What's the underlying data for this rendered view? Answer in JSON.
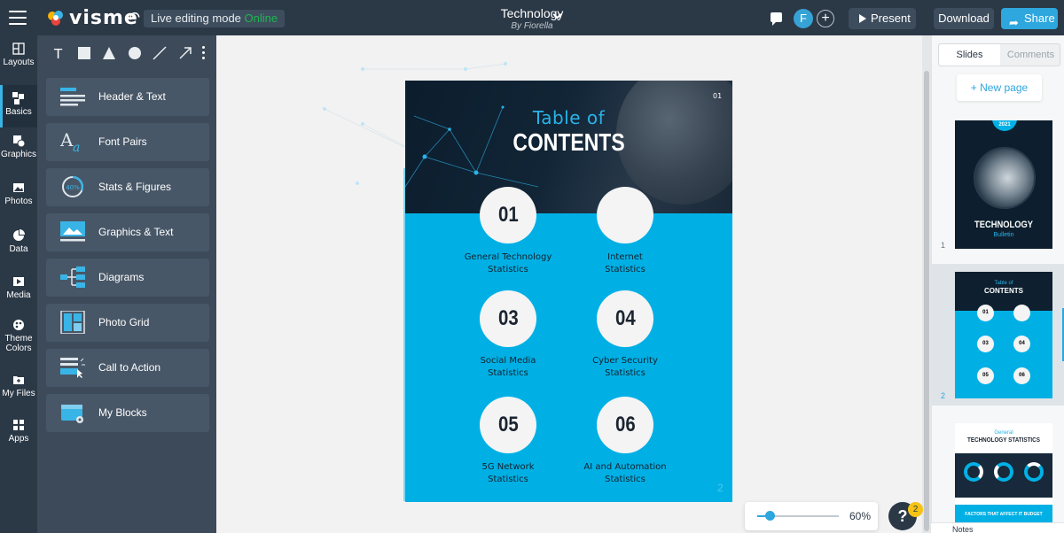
{
  "app": {
    "brand": "visme",
    "mode_label": "Live editing mode",
    "mode_status": "Online",
    "doc_title": "Technology",
    "doc_author": "By Fiorella",
    "user_initial": "F",
    "present_label": "Present",
    "download_label": "Download",
    "share_label": "Share"
  },
  "rail": [
    {
      "label": "Layouts",
      "icon": "layouts-icon"
    },
    {
      "label": "Basics",
      "icon": "basics-icon"
    },
    {
      "label": "Graphics",
      "icon": "graphics-icon"
    },
    {
      "label": "Photos",
      "icon": "photos-icon"
    },
    {
      "label": "Data",
      "icon": "data-icon"
    },
    {
      "label": "Media",
      "icon": "media-icon"
    },
    {
      "label": "Theme",
      "label2": "Colors",
      "icon": "theme-colors-icon"
    },
    {
      "label": "My Files",
      "icon": "my-files-icon"
    },
    {
      "label": "Apps",
      "icon": "apps-icon"
    }
  ],
  "tools": [
    "text-tool-icon",
    "rectangle-tool-icon",
    "triangle-tool-icon",
    "circle-tool-icon",
    "line-tool-icon",
    "arrow-tool-icon"
  ],
  "blocks": [
    {
      "label": "Header & Text",
      "icon": "header-text-icon"
    },
    {
      "label": "Font Pairs",
      "icon": "font-pairs-icon"
    },
    {
      "label": "Stats & Figures",
      "icon": "stats-figures-icon",
      "badge": "40%"
    },
    {
      "label": "Graphics & Text",
      "icon": "graphics-text-icon"
    },
    {
      "label": "Diagrams",
      "icon": "diagrams-icon"
    },
    {
      "label": "Photo Grid",
      "icon": "photo-grid-icon"
    },
    {
      "label": "Call to Action",
      "icon": "call-to-action-icon"
    },
    {
      "label": "My Blocks",
      "icon": "my-blocks-icon"
    }
  ],
  "slide": {
    "page_number": "01",
    "title_pre": "Table of",
    "title_main": "CONTENTS",
    "corner_number": "2",
    "items": [
      {
        "num": "01",
        "line1": "General Technology",
        "line2": "Statistics"
      },
      {
        "num": "",
        "line1": "Internet",
        "line2": "Statistics"
      },
      {
        "num": "03",
        "line1": "Social Media",
        "line2": "Statistics"
      },
      {
        "num": "04",
        "line1": "Cyber Security",
        "line2": "Statistics"
      },
      {
        "num": "05",
        "line1": "5G Network",
        "line2": "Statistics"
      },
      {
        "num": "06",
        "line1": "AI and Automation",
        "line2": "Statistics"
      }
    ]
  },
  "zoom": {
    "label": "60%",
    "level": 0.15
  },
  "help": {
    "label": "?",
    "badge": "2"
  },
  "right_panel": {
    "tabs": [
      "Slides",
      "Comments"
    ],
    "new_page": "+ New page",
    "thumbs": [
      {
        "num": "1",
        "year": "2021",
        "title": "TECHNOLOGY",
        "subtitle": "Bulletin"
      },
      {
        "num": "2",
        "pre": "Table of",
        "title": "CONTENTS"
      },
      {
        "num": "",
        "pre": "General",
        "title": "TECHNOLOGY STATISTICS",
        "footer": "FACTORS THAT AFFECT IT BUDGET"
      }
    ],
    "notes": "Notes"
  },
  "colors": {
    "accent": "#2ea6de",
    "slide_blue": "#00b0e5",
    "topbar": "#2b3846",
    "online": "#1db54f"
  }
}
